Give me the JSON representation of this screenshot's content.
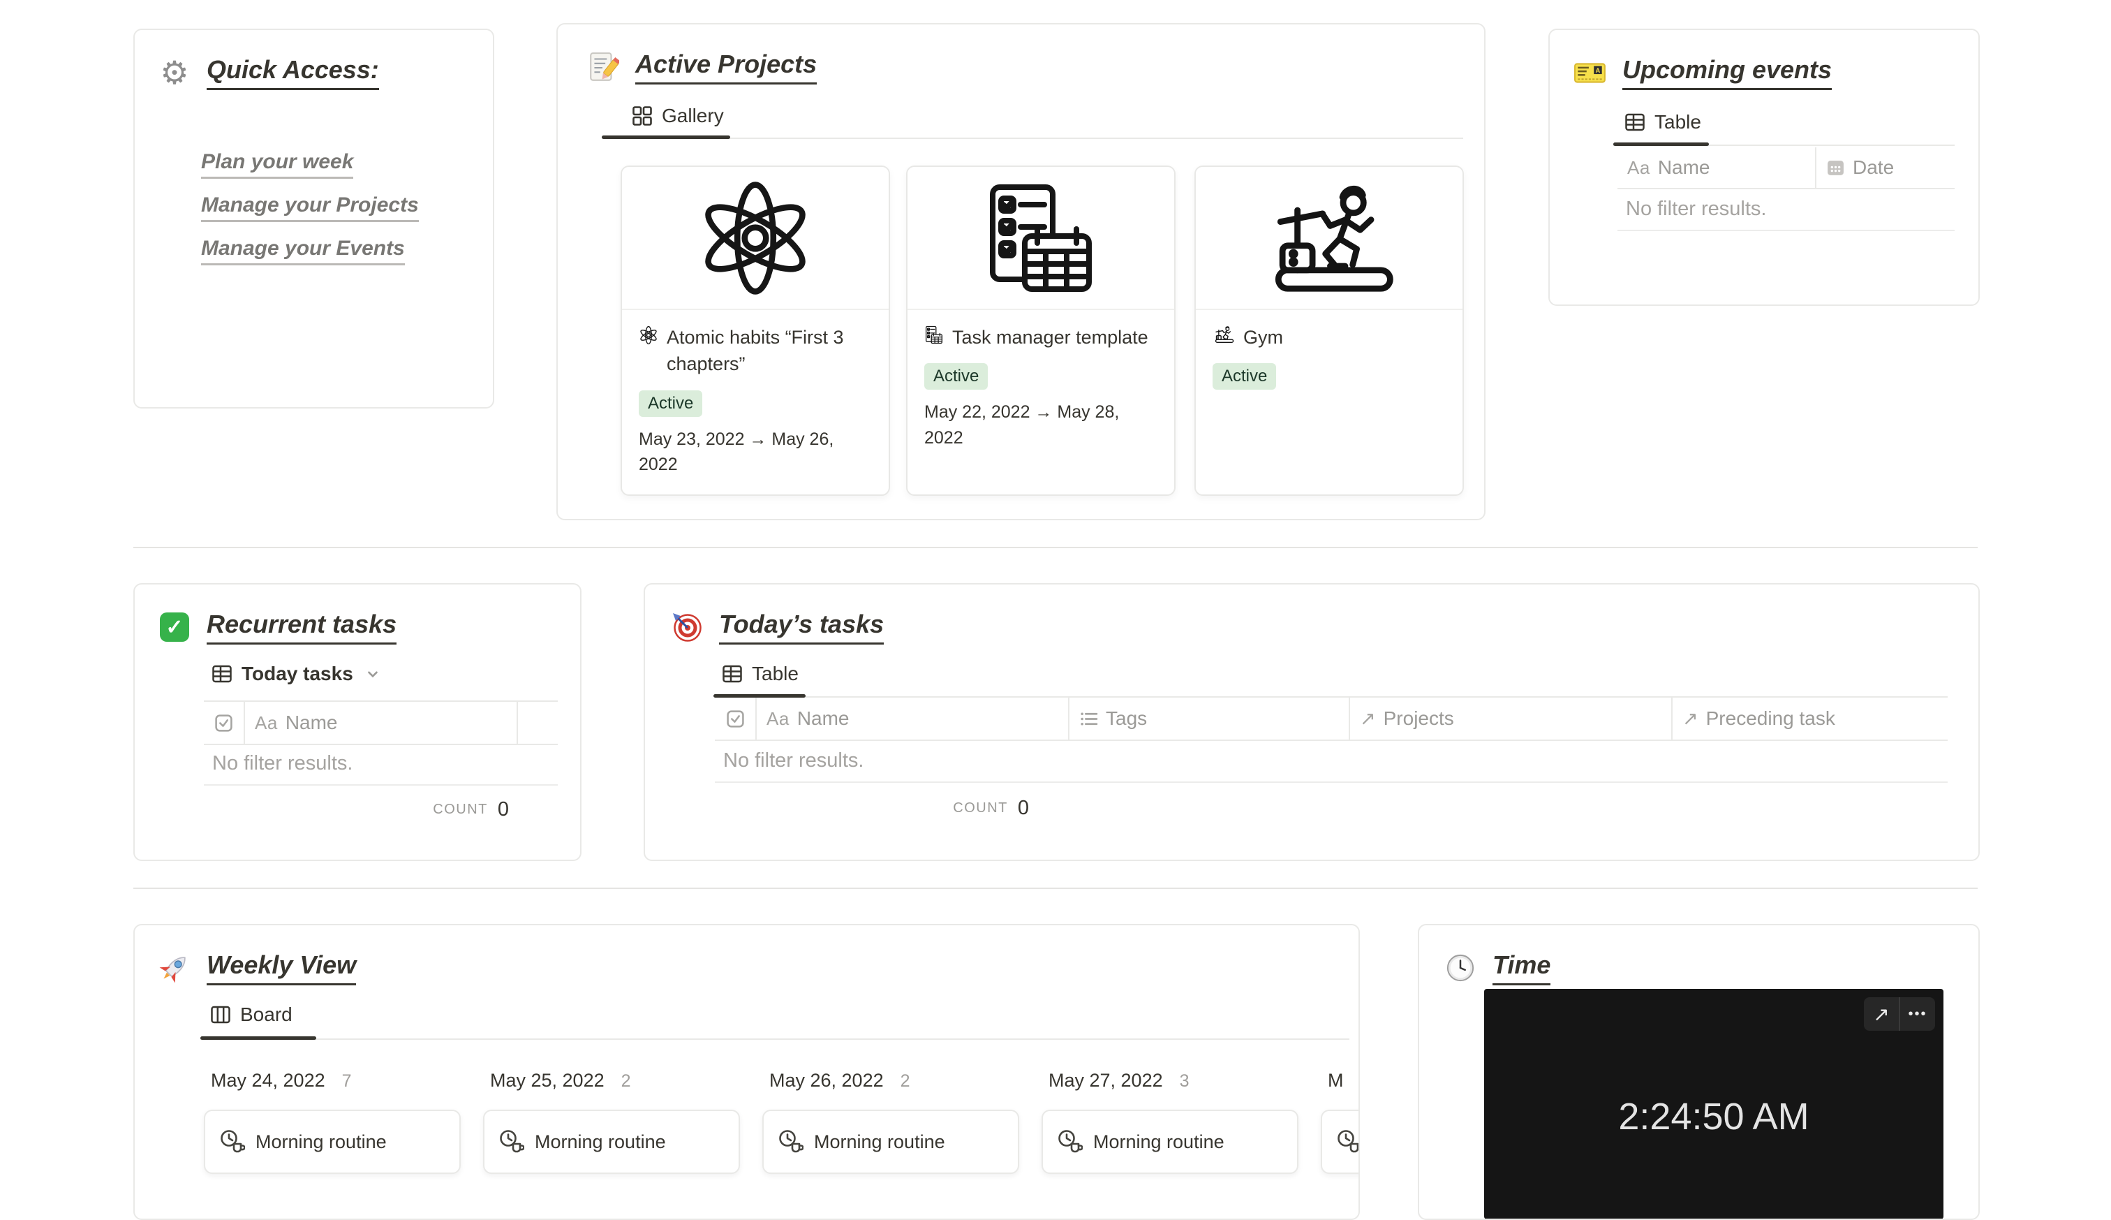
{
  "quick_access": {
    "icon": "gear-emoji",
    "title": "Quick Access:",
    "links": [
      "Plan your week",
      "Manage your Projects",
      "Manage your Events"
    ]
  },
  "active_projects": {
    "icon": "memo-emoji",
    "title": "Active Projects",
    "tab_label": "Gallery",
    "cards": [
      {
        "icon": "atom-icon",
        "title": "Atomic habits “First 3 chapters”",
        "badge": "Active",
        "dates": "May 23, 2022 → May 26, 2022"
      },
      {
        "icon": "task-checklist-icon",
        "title": "Task manager template",
        "badge": "Active",
        "dates": "May 22, 2022 → May 28, 2022"
      },
      {
        "icon": "treadmill-icon",
        "title": "Gym",
        "badge": "Active",
        "dates": ""
      }
    ]
  },
  "upcoming_events": {
    "icon": "tickets-emoji",
    "title": "Upcoming events",
    "tab_label": "Table",
    "columns": {
      "name": "Name",
      "date": "Date"
    },
    "empty_text": "No filter results."
  },
  "recurrent_tasks": {
    "icon": "check-emoji",
    "title": "Recurrent tasks",
    "view_label": "Today tasks",
    "columns": {
      "name": "Name"
    },
    "empty_text": "No filter results.",
    "count_label": "COUNT",
    "count_value": "0"
  },
  "todays_tasks": {
    "icon": "dart-emoji",
    "title": "Today’s tasks",
    "tab_label": "Table",
    "columns": {
      "name": "Name",
      "tags": "Tags",
      "projects": "Projects",
      "preceding": "Preceding task"
    },
    "empty_text": "No filter results.",
    "count_label": "COUNT",
    "count_value": "0"
  },
  "weekly_view": {
    "icon": "rocket-emoji",
    "title": "Weekly View",
    "tab_label": "Board",
    "columns": [
      {
        "date": "May 24, 2022",
        "count": "7",
        "card": "Morning routine"
      },
      {
        "date": "May 25, 2022",
        "count": "2",
        "card": "Morning routine"
      },
      {
        "date": "May 26, 2022",
        "count": "2",
        "card": "Morning routine"
      },
      {
        "date": "May 27, 2022",
        "count": "3",
        "card": "Morning routine"
      },
      {
        "date": "M",
        "count": "",
        "card": ""
      }
    ]
  },
  "time": {
    "icon": "clock-emoji",
    "title": "Time",
    "clock_display": "2:24:50 AM",
    "open_glyph": "↗",
    "more_glyph": "•••"
  },
  "icons": {
    "text_property_glyph": "Aa",
    "relation_glyph": "↗"
  },
  "colors": {
    "text_dark": "#37352f",
    "text_gray": "#787774",
    "muted": "#a5a3a0",
    "border": "#e9e9e7",
    "badge_bg": "#dbeddb",
    "badge_text": "#1c3829",
    "embed_bg": "#151515"
  }
}
